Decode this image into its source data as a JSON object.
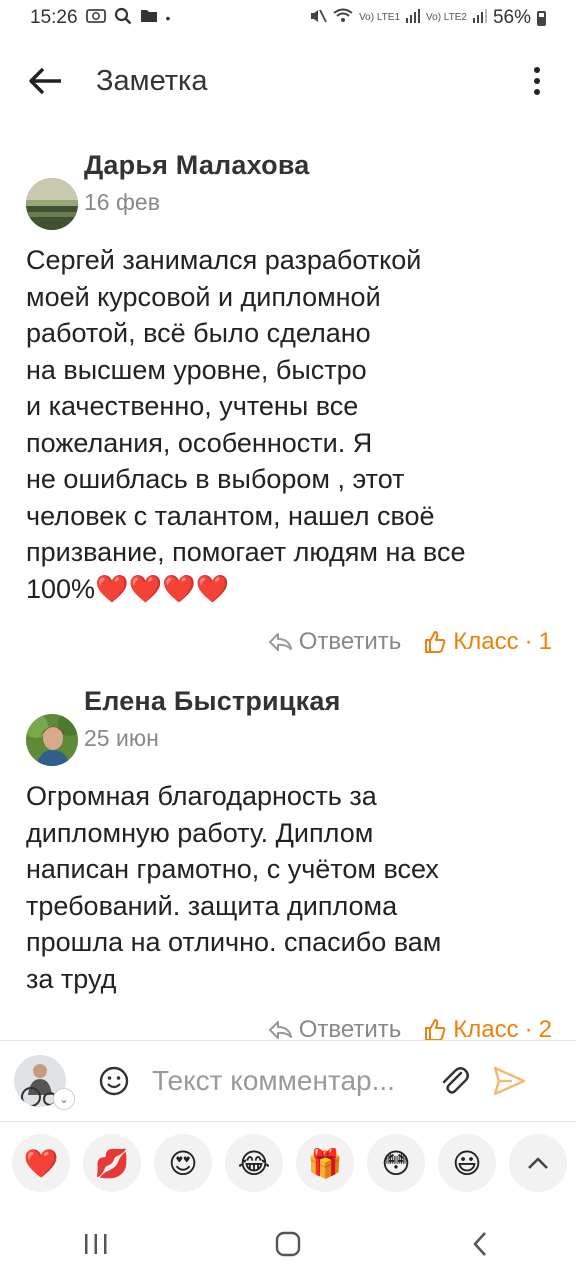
{
  "status_bar": {
    "time": "15:26",
    "battery": "56%",
    "net1": "Vo) LTE1",
    "net2": "Vo) LTE2"
  },
  "app_bar": {
    "title": "Заметка",
    "back_icon": "arrow-left-icon",
    "menu_icon": "more-vertical-icon"
  },
  "comments": [
    {
      "author": "Дарья Малахова",
      "date": "16 фев",
      "lines": [
        "Сергей занимался разработкой",
        "моей курсовой и дипломной",
        "работой, всё было сделано",
        "на высшем уровне, быстро",
        "и качественно, учтены все",
        "пожелания, особенности. Я",
        "не ошиблась в выбором , этот",
        "человек с талантом, нашел своё",
        "призвание, помогает людям на все",
        "100%❤️❤️❤️❤️"
      ],
      "reply_label": "Ответить",
      "like_label": "Класс",
      "likes": "1"
    },
    {
      "author": "Елена Быстрицкая",
      "date": "25 июн",
      "lines": [
        "Огромная благодарность за",
        "дипломную работу. Диплом",
        "написан грамотно, с учётом всех",
        "требований. защита диплома",
        "прошла на отлично. спасибо вам",
        "за труд"
      ],
      "reply_label": "Ответить",
      "like_label": "Класс",
      "likes": "2"
    }
  ],
  "input": {
    "placeholder": "Текст комментар..."
  },
  "reactions": [
    "❤️",
    "💋",
    "😍",
    "😂",
    "🎁",
    "😳",
    "😃"
  ],
  "colors": {
    "accent": "#ee8208",
    "secondary_text": "#888888",
    "reaction_bg": "#f2f2f2"
  }
}
